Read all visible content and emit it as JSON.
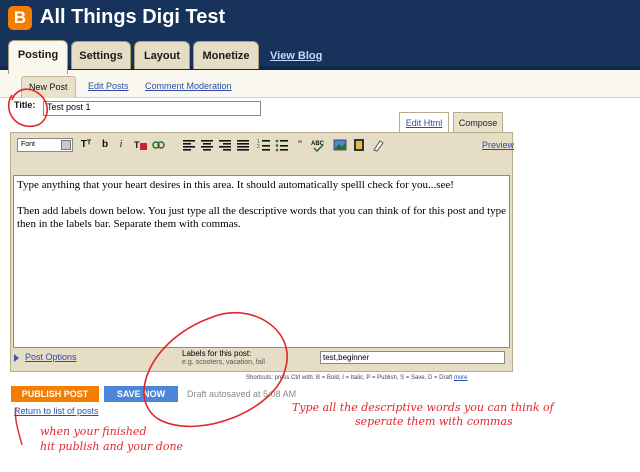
{
  "header": {
    "blog_title": "All Things Digi Test",
    "logo_letter": "B",
    "view_blog": "View Blog",
    "brand_color": "#f57d00"
  },
  "tabs": [
    {
      "label": "Posting",
      "active": true
    },
    {
      "label": "Settings",
      "active": false
    },
    {
      "label": "Layout",
      "active": false
    },
    {
      "label": "Monetize",
      "active": false
    }
  ],
  "subtabs": [
    {
      "label": "New Post",
      "active": true
    },
    {
      "label": "Edit Posts",
      "active": false
    },
    {
      "label": "Comment Moderation",
      "active": false
    }
  ],
  "editor": {
    "title_label": "Title:",
    "title_value": "Test post 1",
    "edit_html": "Edit Html",
    "compose": "Compose",
    "font_label": "Font",
    "preview": "Preview",
    "bold": "b",
    "italic": "i",
    "size_icon": "Tᵀ",
    "body_para1": "Type anything that your heart desires in this area. It should automatically spelll check for you...see!",
    "body_para2": "Then add labels down below. You just type all the descriptive words that you can think of for this post and type then in the labels bar. Separate them with commas.",
    "post_options": "Post Options",
    "labels_label": "Labels for this post:",
    "labels_example": "e.g. scooters, vacation, fall",
    "labels_value": "test,beginner",
    "shortcuts_text": "Shortcuts: press Ctrl with: B = Bold, I = Italic, P = Publish, S = Save, D = Draft",
    "shortcuts_more": "more"
  },
  "actions": {
    "publish": "PUBLISH POST",
    "save_now": "SAVE NOW",
    "draft_status": "Draft autosaved at 5:08 AM",
    "return_link": "Return to list of posts"
  },
  "annotations": {
    "right_line1": "Type all the descriptive words you can think of",
    "right_line2": "seperate them with commas",
    "left_line1": "when your finished",
    "left_line2": "hit publish and your done",
    "ink_color": "#e1262b"
  }
}
